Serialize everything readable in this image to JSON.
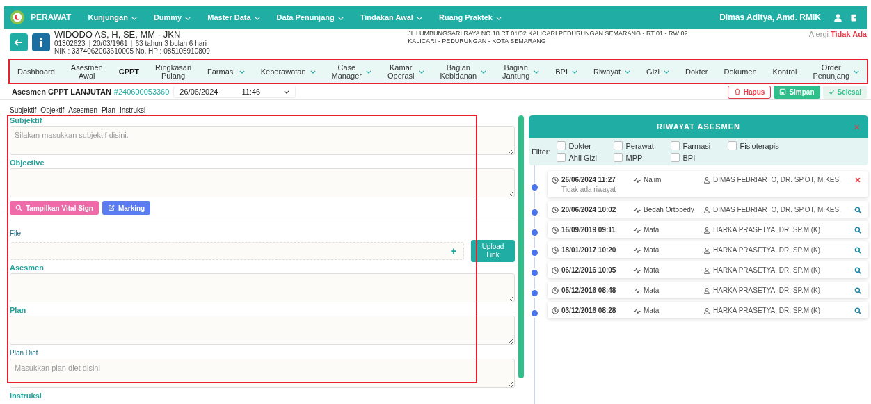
{
  "topbar": {
    "brand": "PERAWAT",
    "menus": [
      {
        "label": "Kunjungan"
      },
      {
        "label": "Dummy"
      },
      {
        "label": "Master Data"
      },
      {
        "label": "Data Penunjang"
      },
      {
        "label": "Tindakan Awal"
      },
      {
        "label": "Ruang Praktek"
      }
    ],
    "user": "Dimas Aditya, Amd. RMIK"
  },
  "patient": {
    "name": "WIDODO AS, H, SE, MM - JKN",
    "rm": "01302623",
    "dob": "20/03/1961",
    "age": "63 tahun 3 bulan 6 hari",
    "ids": "NIK : 3374062003610005 No. HP : 085105910809",
    "address": "JL LUMBUNGSARI RAYA NO 18 RT 01/02 KALICARI PEDURUNGAN SEMARANG - RT 01 - RW 02",
    "area": "KALICARI - PEDURUNGAN - KOTA SEMARANG",
    "allergy_label": "Alergi",
    "allergy_value": "Tidak Ada"
  },
  "nav": [
    {
      "label": "Dashboard",
      "dropdown": false,
      "selected": false
    },
    {
      "label": "Asesmen Awal",
      "dropdown": false,
      "selected": false
    },
    {
      "label": "CPPT",
      "dropdown": false,
      "selected": true
    },
    {
      "label": "Ringkasan Pulang",
      "dropdown": false,
      "selected": false
    },
    {
      "label": "Farmasi",
      "dropdown": true,
      "selected": false
    },
    {
      "label": "Keperawatan",
      "dropdown": true,
      "selected": false
    },
    {
      "label": "Case Manager",
      "dropdown": true,
      "selected": false
    },
    {
      "label": "Kamar Operasi",
      "dropdown": true,
      "selected": false
    },
    {
      "label": "Bagian Kebidanan",
      "dropdown": true,
      "selected": false
    },
    {
      "label": "Bagian Jantung",
      "dropdown": true,
      "selected": false
    },
    {
      "label": "BPI",
      "dropdown": true,
      "selected": false
    },
    {
      "label": "Riwayat",
      "dropdown": true,
      "selected": false
    },
    {
      "label": "Gizi",
      "dropdown": true,
      "selected": false
    },
    {
      "label": "Dokter",
      "dropdown": false,
      "selected": false
    },
    {
      "label": "Dokumen",
      "dropdown": false,
      "selected": false
    },
    {
      "label": "Kontrol",
      "dropdown": false,
      "selected": false
    },
    {
      "label": "Order Penunjang",
      "dropdown": true,
      "selected": false
    }
  ],
  "form_header": {
    "title": "Asesmen CPPT LANJUTAN",
    "number": "#240600053360",
    "date": "26/06/2024",
    "time": "11:46",
    "delete": "Hapus",
    "save": "Simpan",
    "done": "Selesai"
  },
  "sections": [
    "Subjektif",
    "Objektif",
    "Asesmen",
    "Plan",
    "Instruksi"
  ],
  "form": {
    "subjektif": {
      "label": "Subjektif",
      "placeholder": "Silakan masukkan subjektif disini."
    },
    "objective": {
      "label": "Objective"
    },
    "vital_button": "Tampilkan Vital Sign",
    "marking_button": "Marking",
    "file_label": "File",
    "file_add": "+",
    "upload_button": "Upload Link",
    "asesmen": {
      "label": "Asesmen"
    },
    "plan": {
      "label": "Plan"
    },
    "plan_diet": {
      "label": "Plan Diet",
      "placeholder": "Masukkan plan diet disini"
    },
    "instruksi": {
      "label": "Instruksi"
    }
  },
  "history": {
    "title": "RIWAYAT ASESMEN",
    "close": "×",
    "filter_label": "Filter:",
    "filters": [
      {
        "label": "Dokter",
        "checked": false
      },
      {
        "label": "Perawat",
        "checked": false
      },
      {
        "label": "Farmasi",
        "checked": false
      },
      {
        "label": "Fisioterapis",
        "checked": false
      },
      {
        "label": "Ahli Gizi",
        "checked": false
      },
      {
        "label": "MPP",
        "checked": false
      },
      {
        "label": "BPI",
        "checked": false
      }
    ],
    "entries": [
      {
        "datetime": "26/06/2024 11:27",
        "unit": "Na'im",
        "doctor": "DIMAS FEBRIARTO, DR. SP.OT, M.KES.",
        "note": "Tidak ada riwayat",
        "kind": "delete"
      },
      {
        "datetime": "20/06/2024 10:02",
        "unit": "Bedah Ortopedy",
        "doctor": "DIMAS FEBRIARTO, DR. SP.OT, M.KES.",
        "kind": "view"
      },
      {
        "datetime": "16/09/2019 09:11",
        "unit": "Mata",
        "doctor": "HARKA PRASETYA, DR, SP.M (K)",
        "kind": "view"
      },
      {
        "datetime": "18/01/2017 10:20",
        "unit": "Mata",
        "doctor": "HARKA PRASETYA, DR, SP.M (K)",
        "kind": "view"
      },
      {
        "datetime": "06/12/2016 10:05",
        "unit": "Mata",
        "doctor": "HARKA PRASETYA, DR, SP.M (K)",
        "kind": "view"
      },
      {
        "datetime": "05/12/2016 08:48",
        "unit": "Mata",
        "doctor": "HARKA PRASETYA, DR, SP.M (K)",
        "kind": "view"
      },
      {
        "datetime": "03/12/2016 08:28",
        "unit": "Mata",
        "doctor": "HARKA PRASETYA, DR, SP.M (K)",
        "kind": "view"
      }
    ]
  }
}
